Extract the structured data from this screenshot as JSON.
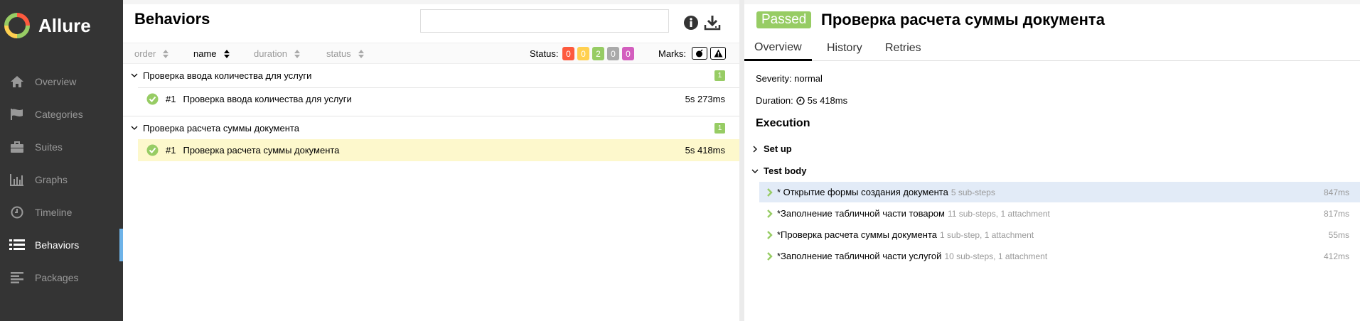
{
  "app": {
    "name": "Allure"
  },
  "sidebar": {
    "items": [
      {
        "label": "Overview",
        "icon": "home-icon",
        "active": false
      },
      {
        "label": "Categories",
        "icon": "flag-icon",
        "active": false
      },
      {
        "label": "Suites",
        "icon": "briefcase-icon",
        "active": false
      },
      {
        "label": "Graphs",
        "icon": "bar-chart-icon",
        "active": false
      },
      {
        "label": "Timeline",
        "icon": "clock-icon",
        "active": false
      },
      {
        "label": "Behaviors",
        "icon": "list-icon",
        "active": true
      },
      {
        "label": "Packages",
        "icon": "align-left-icon",
        "active": false
      }
    ]
  },
  "left": {
    "title": "Behaviors",
    "search": {
      "value": "",
      "placeholder": ""
    },
    "sort": {
      "order": "order",
      "name": "name",
      "duration": "duration",
      "status": "status"
    },
    "status_label": "Status:",
    "status_counts": [
      {
        "value": "0",
        "color": "#fd5a3e"
      },
      {
        "value": "0",
        "color": "#ffd050"
      },
      {
        "value": "2",
        "color": "#97cc64"
      },
      {
        "value": "0",
        "color": "#aaaaaa"
      },
      {
        "value": "0",
        "color": "#d35ebe"
      }
    ],
    "marks_label": "Marks:",
    "groups": [
      {
        "name": "Проверка ввода количества для услуги",
        "count": "1",
        "tests": [
          {
            "num": "#1",
            "name": "Проверка ввода количества для услуги",
            "duration": "5s 273ms",
            "selected": false
          }
        ]
      },
      {
        "name": "Проверка расчета суммы документа",
        "count": "1",
        "tests": [
          {
            "num": "#1",
            "name": "Проверка расчета суммы документа",
            "duration": "5s 418ms",
            "selected": true
          }
        ]
      }
    ]
  },
  "right": {
    "status": "Passed",
    "status_color": "#97cc64",
    "title": "Проверка расчета суммы документа",
    "tabs": [
      "Overview",
      "History",
      "Retries"
    ],
    "severity": "Severity: normal",
    "duration_label": "Duration:",
    "duration_value": "5s 418ms",
    "execution_heading": "Execution",
    "setup_label": "Set up",
    "body_label": "Test body",
    "steps": [
      {
        "name": "* Открытие формы создания документа",
        "meta": "5 sub-steps",
        "duration": "847ms",
        "highlighted": true
      },
      {
        "name": "*Заполнение табличной части товаром",
        "meta": "11 sub-steps, 1 attachment",
        "duration": "817ms",
        "highlighted": false
      },
      {
        "name": "*Проверка расчета суммы документа",
        "meta": "1 sub-step, 1 attachment",
        "duration": "55ms",
        "highlighted": false
      },
      {
        "name": "*Заполнение табличной части услугой",
        "meta": "10 sub-steps, 1 attachment",
        "duration": "412ms",
        "highlighted": false
      }
    ]
  }
}
